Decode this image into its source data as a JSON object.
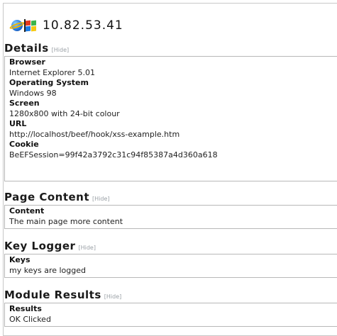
{
  "host": {
    "ip": "10.82.53.41",
    "browser_icon": "internet-explorer-icon",
    "os_icon": "windows-icon"
  },
  "hide_label": "[Hide]",
  "details": {
    "title": "Details",
    "browser_label": "Browser",
    "browser_value": "Internet Explorer 5.01",
    "os_label": "Operating System",
    "os_value": "Windows 98",
    "screen_label": "Screen",
    "screen_value": "1280x800 with 24-bit colour",
    "url_label": "URL",
    "url_value": "http://localhost/beef/hook/xss-example.htm",
    "cookie_label": "Cookie",
    "cookie_value": "BeEFSession=99f42a3792c31c94f85387a4d360a618"
  },
  "page_content": {
    "title": "Page Content",
    "content_label": "Content",
    "content_value": "The main page more content"
  },
  "key_logger": {
    "title": "Key Logger",
    "keys_label": "Keys",
    "keys_value": "my keys are logged"
  },
  "module_results": {
    "title": "Module Results",
    "results_label": "Results",
    "results_value": "OK Clicked"
  }
}
